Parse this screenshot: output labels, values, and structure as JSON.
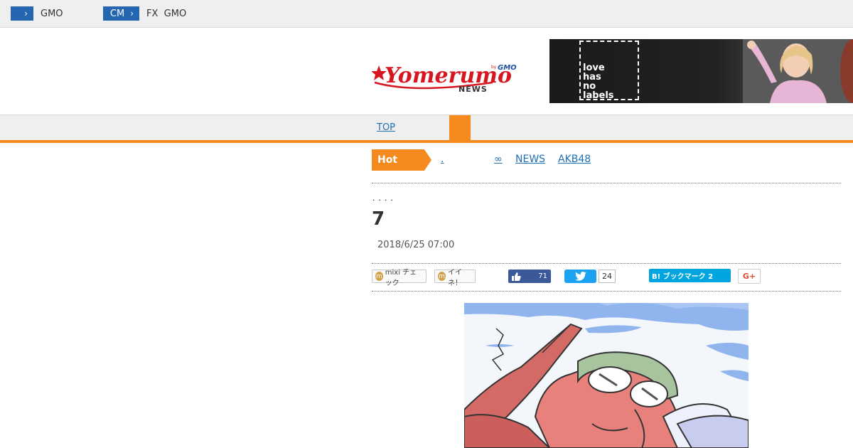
{
  "topbar": {
    "items": [
      {
        "button_label": "",
        "text": "GMO"
      },
      {
        "button_label": "CM",
        "text": "FX  GMO"
      }
    ],
    "chevron": "›"
  },
  "header": {
    "logo_main": "Yomerumo",
    "logo_sub": "NEWS",
    "logo_by": "by",
    "logo_brand": "GMO",
    "banner_text": "love\nhas\nno\nlabels"
  },
  "nav": {
    "top_label": "TOP"
  },
  "hot": {
    "label": "Hot",
    "links": [
      ".",
      "∞",
      "NEWS",
      "AKB48"
    ]
  },
  "article": {
    "breadcrumb": "．．．．",
    "title": "7",
    "date": "2018/6/25 07:00"
  },
  "share": {
    "mixi_label": "mixi チェック",
    "iine_label": "イイネ！",
    "fb_count": "71",
    "tw_count": "24",
    "hatena_label": "B! ブックマーク 2",
    "gplus_label": "G+"
  },
  "colors": {
    "accent_orange": "#f58a1f",
    "link_blue": "#1f6fb3",
    "topbar_button": "#2466b0",
    "facebook": "#3b5998",
    "twitter": "#1da1f2",
    "hatena": "#00a4de"
  }
}
